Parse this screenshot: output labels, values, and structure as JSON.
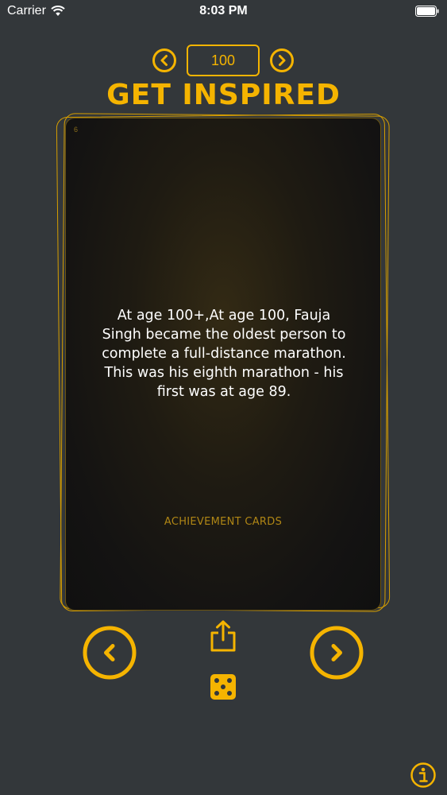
{
  "status_bar": {
    "carrier": "Carrier",
    "time": "8:03 PM"
  },
  "nav": {
    "counter_value": "100"
  },
  "title": "GET INSPIRED",
  "card": {
    "index": "6",
    "text": "At age 100+,At age 100, Fauja Singh became the oldest person to complete a full-distance marathon. This was his eighth marathon - his first was at age 89.",
    "category": "ACHIEVEMENT CARDS"
  },
  "colors": {
    "accent": "#f5b400",
    "background": "#33373a",
    "card_background": "#141312",
    "category_text": "#b08615"
  },
  "icons": {
    "prev_small": "chevron-left-circle-icon",
    "next_small": "chevron-right-circle-icon",
    "prev_big": "chevron-left-circle-icon",
    "next_big": "chevron-right-circle-icon",
    "share": "share-icon",
    "dice": "dice-icon",
    "info": "info-icon"
  }
}
